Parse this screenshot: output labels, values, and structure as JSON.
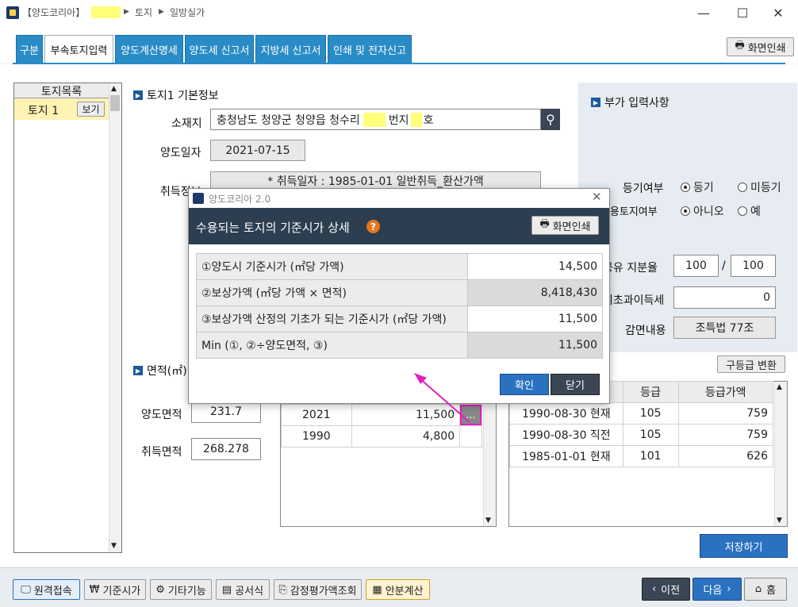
{
  "window": {
    "title_prefix": "【양도코리아】",
    "crumb1": "토지",
    "crumb2": "일방실가",
    "min": "—",
    "max": "☐",
    "close": "✕"
  },
  "tabs": [
    "구분",
    "부속토지입력",
    "양도계산명세",
    "양도세 신고서",
    "지방세 신고서",
    "인쇄 및 전자신고"
  ],
  "print_label": "화면인쇄",
  "land_list": {
    "header": "토지목록",
    "item_label": "토지 1",
    "view_label": "보기"
  },
  "basic": {
    "title": "토지1 기본정보",
    "location_label": "소재지",
    "location_part1": "충청남도 청양군 청양읍 청수리",
    "location_part2": "번지",
    "location_part3": "호",
    "transfer_date_label": "양도일자",
    "transfer_date": "2021-07-15",
    "acq_label": "취득정보",
    "acq_info": "* 취득일자 : 1985-01-01   일반취득_환산가액"
  },
  "extra": {
    "title": "부가 입력사항",
    "reg_label": "등기여부",
    "reg_yes": "등기",
    "reg_no": "미등기",
    "biz_label": "사업용토지여부",
    "biz_no": "아니오",
    "biz_yes": "예",
    "share_label": "공유 지분율",
    "share_a": "100",
    "share_sep": "/",
    "share_b": "100",
    "excess_label": "기초과이득세",
    "excess_value": "0",
    "reduction_label": "감면내용",
    "reduction_value": "조특법 77조"
  },
  "area": {
    "title": "면적(㎡)",
    "transfer_label": "양도면적",
    "transfer_value": "231.7",
    "acq_label": "취득면적",
    "acq_value": "268.278"
  },
  "price_table": {
    "rows": [
      {
        "year": "2021",
        "price": "11,500",
        "more": "..."
      },
      {
        "year": "1990",
        "price": "4,800"
      }
    ]
  },
  "grade": {
    "convert_label": "구등급 변환",
    "headers": [
      "",
      "등급",
      "등급가액"
    ],
    "rows": [
      {
        "date": "1990-08-30 현재",
        "grade": "105",
        "value": "759"
      },
      {
        "date": "1990-08-30 직전",
        "grade": "105",
        "value": "759"
      },
      {
        "date": "1985-01-01 현재",
        "grade": "101",
        "value": "626"
      }
    ]
  },
  "save_label": "저장하기",
  "bottom": {
    "remote": "원격접속",
    "std_price": "기준시가",
    "other": "기타기능",
    "formula": "공서식",
    "appraisal": "감정평가액조회",
    "apportion": "안분계산",
    "prev": "이전",
    "next": "다음",
    "home": "홈"
  },
  "dialog": {
    "window_title": "양도코리아 2.0",
    "heading": "수용되는 토지의 기준시가 상세",
    "help": "?",
    "print_label": "화면인쇄",
    "rows": [
      {
        "label": "①양도시 기준시가 (㎡당 가액)",
        "value": "14,500"
      },
      {
        "label": "②보상가액 (㎡당 가액 × 면적)",
        "value": "8,418,430"
      },
      {
        "label": "③보상가액 산정의 기초가 되는 기준시가 (㎡당 가액)",
        "value": "11,500"
      },
      {
        "label": "Min (①, ②÷양도면적, ③)",
        "value": "11,500"
      }
    ],
    "ok": "확인",
    "close": "닫기"
  },
  "colors": {
    "tab": "#2a8cc6",
    "dialog_header": "#2c3e50",
    "ok_button": "#2a72c0",
    "highlight": "#e020c0"
  }
}
